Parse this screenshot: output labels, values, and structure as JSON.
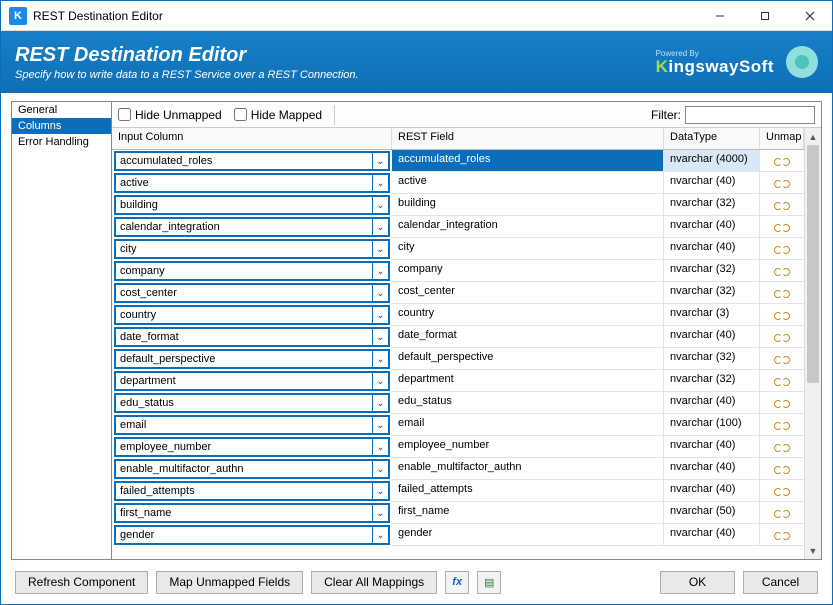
{
  "titlebar": {
    "title": "REST Destination Editor",
    "app_letter": "K"
  },
  "header": {
    "title": "REST Destination Editor",
    "subtitle": "Specify how to write data to a REST Service over a REST Connection.",
    "powered_by": "Powered By",
    "brand": "KingswaySoft"
  },
  "sidebar": {
    "items": [
      {
        "label": "General"
      },
      {
        "label": "Columns"
      },
      {
        "label": "Error Handling"
      }
    ],
    "selected_index": 1
  },
  "toolbar": {
    "hide_unmapped": "Hide Unmapped",
    "hide_mapped": "Hide Mapped",
    "filter_label": "Filter:",
    "filter_value": ""
  },
  "grid": {
    "headers": {
      "input": "Input Column",
      "rest": "REST Field",
      "datatype": "DataType",
      "unmap": "Unmap"
    },
    "rows": [
      {
        "input": "accumulated_roles",
        "rest": "accumulated_roles",
        "dt": "nvarchar (4000)"
      },
      {
        "input": "active",
        "rest": "active",
        "dt": "nvarchar (40)"
      },
      {
        "input": "building",
        "rest": "building",
        "dt": "nvarchar (32)"
      },
      {
        "input": "calendar_integration",
        "rest": "calendar_integration",
        "dt": "nvarchar (40)"
      },
      {
        "input": "city",
        "rest": "city",
        "dt": "nvarchar (40)"
      },
      {
        "input": "company",
        "rest": "company",
        "dt": "nvarchar (32)"
      },
      {
        "input": "cost_center",
        "rest": "cost_center",
        "dt": "nvarchar (32)"
      },
      {
        "input": "country",
        "rest": "country",
        "dt": "nvarchar (3)"
      },
      {
        "input": "date_format",
        "rest": "date_format",
        "dt": "nvarchar (40)"
      },
      {
        "input": "default_perspective",
        "rest": "default_perspective",
        "dt": "nvarchar (32)"
      },
      {
        "input": "department",
        "rest": "department",
        "dt": "nvarchar (32)"
      },
      {
        "input": "edu_status",
        "rest": "edu_status",
        "dt": "nvarchar (40)"
      },
      {
        "input": "email",
        "rest": "email",
        "dt": "nvarchar (100)"
      },
      {
        "input": "employee_number",
        "rest": "employee_number",
        "dt": "nvarchar (40)"
      },
      {
        "input": "enable_multifactor_authn",
        "rest": "enable_multifactor_authn",
        "dt": "nvarchar (40)"
      },
      {
        "input": "failed_attempts",
        "rest": "failed_attempts",
        "dt": "nvarchar (40)"
      },
      {
        "input": "first_name",
        "rest": "first_name",
        "dt": "nvarchar (50)"
      },
      {
        "input": "gender",
        "rest": "gender",
        "dt": "nvarchar (40)"
      }
    ]
  },
  "buttons": {
    "refresh": "Refresh Component",
    "map_unmapped": "Map Unmapped Fields",
    "clear_all": "Clear All Mappings",
    "ok": "OK",
    "cancel": "Cancel"
  },
  "icons": {
    "fx": "fx",
    "props": "▤"
  }
}
